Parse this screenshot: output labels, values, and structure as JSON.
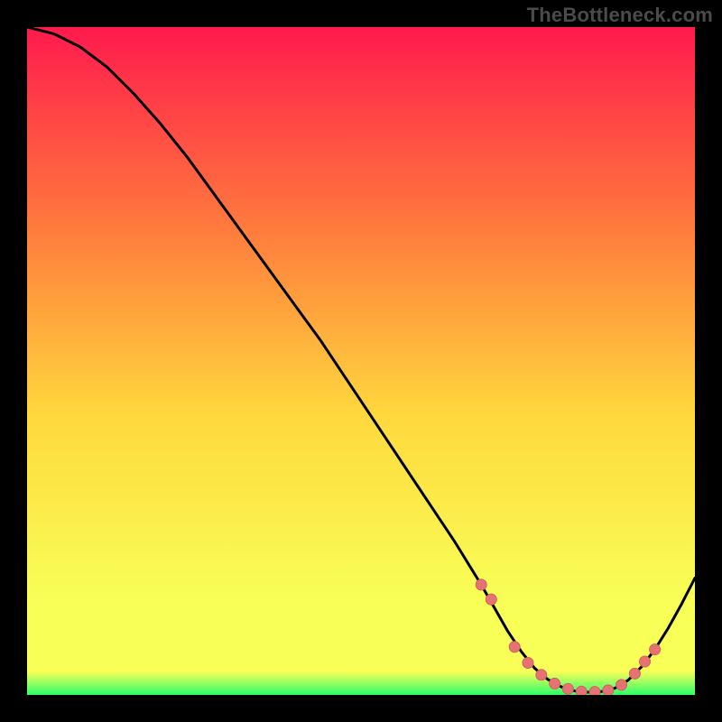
{
  "watermark": "TheBottleneck.com",
  "colors": {
    "frame": "#000000",
    "grad_top": "#ff1a4d",
    "grad_mid1": "#ff7a3d",
    "grad_mid2": "#ffd83d",
    "grad_mid3": "#f8ff57",
    "grad_bottom": "#2cff6b",
    "curve": "#000000",
    "marker_fill": "#e57373",
    "marker_stroke": "#d55f5f"
  },
  "chart_data": {
    "type": "line",
    "title": "",
    "xlabel": "",
    "ylabel": "",
    "xlim": [
      0,
      100
    ],
    "ylim": [
      0,
      100
    ],
    "series": [
      {
        "name": "bottleneck-curve",
        "x": [
          0,
          4,
          8,
          12,
          16,
          20,
          24,
          28,
          32,
          36,
          40,
          44,
          48,
          52,
          56,
          60,
          64,
          68,
          70,
          72,
          74,
          76,
          78,
          80,
          82,
          84,
          86,
          88,
          90,
          92,
          94,
          96,
          98,
          100
        ],
        "y": [
          100,
          99,
          97,
          94,
          90,
          85.5,
          80.5,
          75,
          69.5,
          64,
          58.5,
          53,
          47,
          41,
          35,
          29,
          23,
          16.5,
          13,
          9.5,
          6.5,
          4,
          2.3,
          1.2,
          0.6,
          0.4,
          0.5,
          1,
          2.2,
          4.2,
          6.8,
          10,
          13.6,
          17.5
        ]
      }
    ],
    "markers": {
      "name": "highlight-points",
      "x": [
        68,
        69.5,
        73,
        75,
        77,
        79,
        81,
        83,
        85,
        87,
        89,
        91,
        92.5,
        94
      ],
      "y": [
        16.5,
        14.3,
        7.2,
        4.8,
        3.0,
        1.7,
        0.9,
        0.5,
        0.45,
        0.7,
        1.5,
        3.2,
        5.0,
        6.8
      ]
    }
  }
}
